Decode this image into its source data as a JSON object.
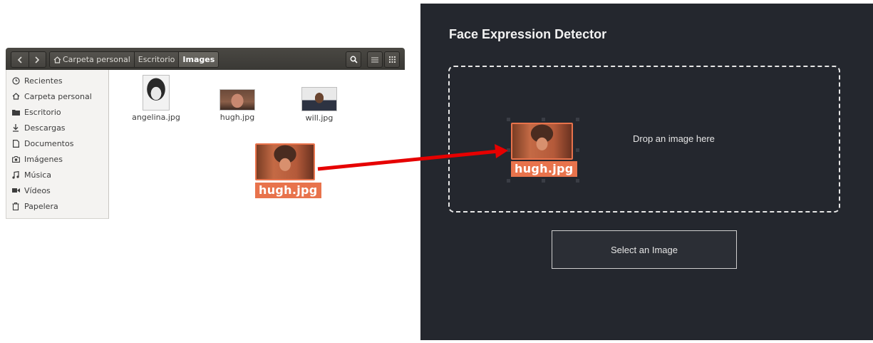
{
  "file_manager": {
    "nav": {
      "back_icon": "chevron-left-icon",
      "forward_icon": "chevron-right-icon"
    },
    "breadcrumbs": [
      {
        "label": "Carpeta personal",
        "icon": "home-icon"
      },
      {
        "label": "Escritorio"
      },
      {
        "label": "Images",
        "active": true
      }
    ],
    "header_buttons": [
      "search-icon",
      "list-view-icon",
      "grid-view-icon"
    ],
    "sidebar": [
      {
        "label": "Recientes",
        "icon": "clock-icon"
      },
      {
        "label": "Carpeta personal",
        "icon": "home-icon"
      },
      {
        "label": "Escritorio",
        "icon": "folder-icon"
      },
      {
        "label": "Descargas",
        "icon": "download-icon"
      },
      {
        "label": "Documentos",
        "icon": "document-icon"
      },
      {
        "label": "Imágenes",
        "icon": "camera-icon"
      },
      {
        "label": "Música",
        "icon": "music-icon"
      },
      {
        "label": "Vídeos",
        "icon": "video-icon"
      },
      {
        "label": "Papelera",
        "icon": "trash-icon"
      }
    ],
    "files": [
      {
        "name": "angelina.jpg"
      },
      {
        "name": "hugh.jpg"
      },
      {
        "name": "will.jpg"
      }
    ],
    "dragging": {
      "label": "hugh.jpg"
    }
  },
  "app": {
    "title": "Face Expression Detector",
    "dropzone_text": "Drop an image here",
    "select_button": "Select an Image",
    "dragging_label": "hugh.jpg"
  },
  "colors": {
    "app_background": "#24272e",
    "drag_highlight": "#e8734c",
    "arrow": "#e60000"
  }
}
